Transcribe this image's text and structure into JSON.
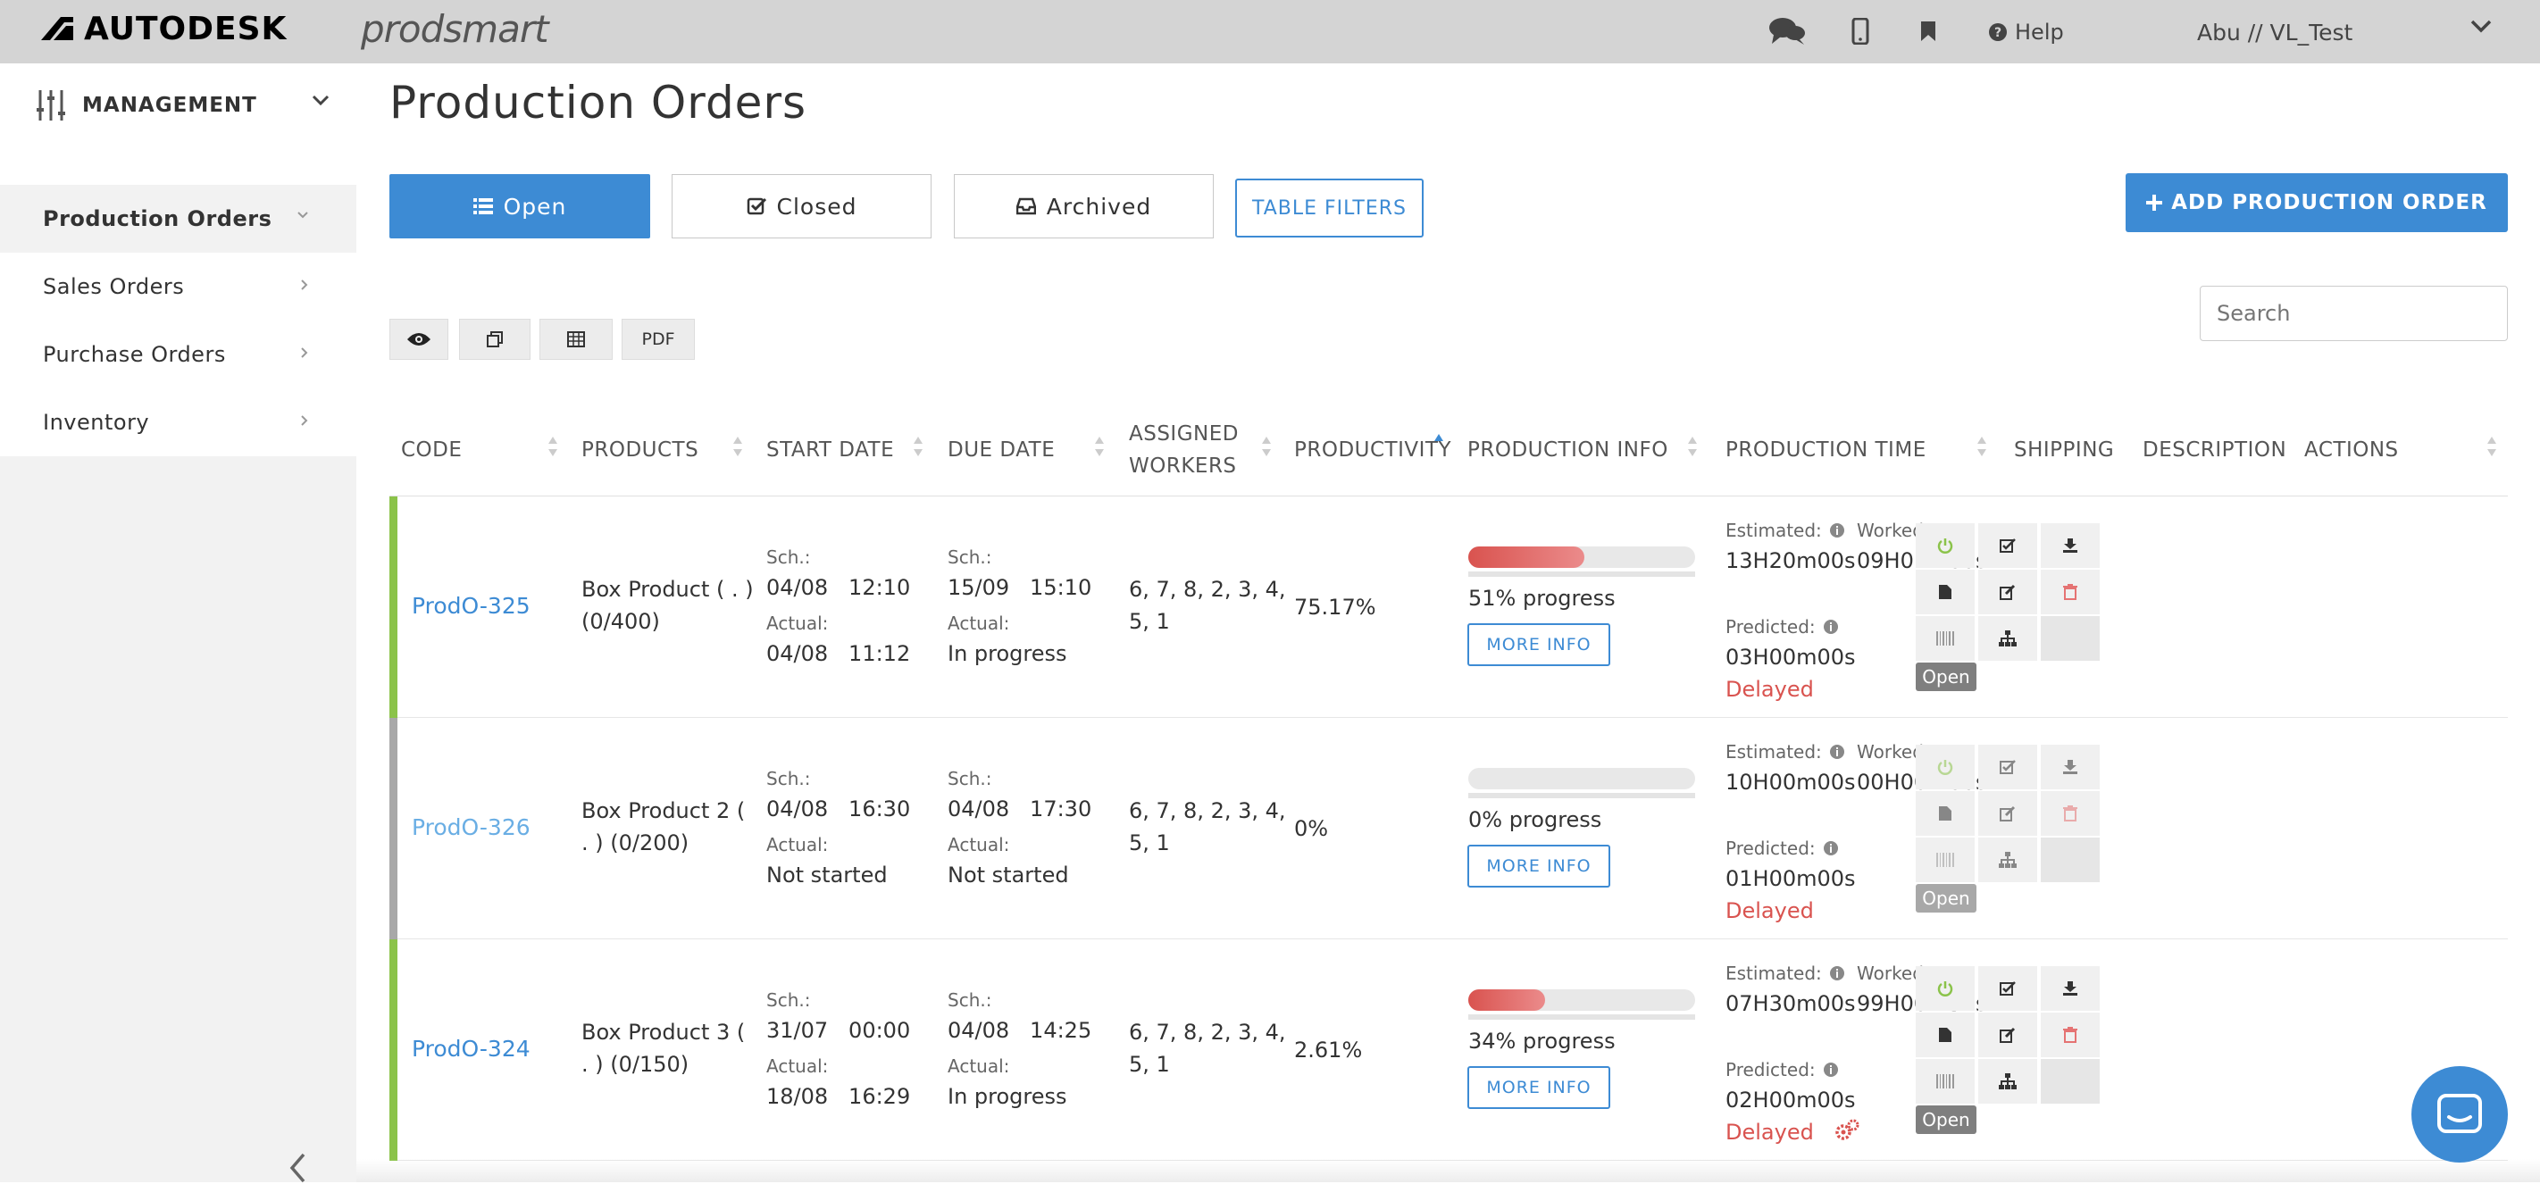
{
  "topbar": {
    "brand": "AUTODESK",
    "product": "prodsmart",
    "help_label": "Help",
    "user_label": "Abu // VL_Test"
  },
  "sidebar": {
    "section_label": "MANAGEMENT",
    "items": [
      {
        "label": "Production Orders",
        "active": true
      },
      {
        "label": "Sales Orders"
      },
      {
        "label": "Purchase Orders"
      },
      {
        "label": "Inventory"
      }
    ]
  },
  "page": {
    "title": "Production Orders",
    "tabs": {
      "open": "Open",
      "closed": "Closed",
      "archived": "Archived"
    },
    "table_filters": "TABLE FILTERS",
    "add_button": "ADD PRODUCTION ORDER",
    "search_placeholder": "Search",
    "pdf_label": "PDF"
  },
  "table": {
    "headers": {
      "code": "CODE",
      "products": "PRODUCTS",
      "start": "START DATE",
      "due": "DUE DATE",
      "workers_1": "ASSIGNED",
      "workers_2": "WORKERS",
      "productivity": "PRODUCTIVITY",
      "prod_info": "PRODUCTION INFO",
      "prod_time": "PRODUCTION TIME",
      "shipping": "SHIPPING",
      "description": "DESCRIPTION",
      "actions": "ACTIONS"
    },
    "labels": {
      "sch": "Sch.:",
      "actual": "Actual:",
      "estimated": "Estimated:",
      "worked": "Worked:",
      "predicted": "Predicted:",
      "more_info": "MORE INFO",
      "open_badge": "Open"
    },
    "rows": [
      {
        "code": "ProdO-325",
        "product_1": "Box Product ( . )",
        "product_2": "(0/400)",
        "start_sch": "04/08   12:10",
        "start_actual": "04/08   11:12",
        "due_sch": "15/09   15:10",
        "due_actual": "In progress",
        "workers_1": "6, 7, 8, 2, 3, 4,",
        "workers_2": "5, 1",
        "productivity": "75.17%",
        "progress": 0.51,
        "progress_text": "51% progress",
        "estimated": "13H20m00s",
        "worked": "09H01m00s",
        "predicted": "03H00m00s",
        "status": "Delayed"
      },
      {
        "code": "ProdO-326",
        "product_1": "Box Product 2 (",
        "product_2": ". ) (0/200)",
        "start_sch": "04/08   16:30",
        "start_actual": "Not started",
        "due_sch": "04/08   17:30",
        "due_actual": "Not started",
        "workers_1": "6, 7, 8, 2, 3, 4,",
        "workers_2": "5, 1",
        "productivity": "0%",
        "progress": 0,
        "progress_text": "0% progress",
        "estimated": "10H00m00s",
        "worked": "00H00m00s",
        "predicted": "01H00m00s",
        "status": "Delayed"
      },
      {
        "code": "ProdO-324",
        "product_1": "Box Product 3 (",
        "product_2": ". ) (0/150)",
        "start_sch": "31/07   00:00",
        "start_actual": "18/08   16:29",
        "due_sch": "04/08   14:25",
        "due_actual": "In progress",
        "workers_1": "6, 7, 8, 2, 3, 4,",
        "workers_2": "5, 1",
        "productivity": "2.61%",
        "progress": 0.34,
        "progress_text": "34% progress",
        "estimated": "07H30m00s",
        "worked": "99H00m54s",
        "predicted": "02H00m00s",
        "status": "Delayed"
      }
    ]
  },
  "colors": {
    "primary": "#3d8bd4",
    "green": "#8bc34a",
    "gray_bar": "#a8a8a8",
    "danger": "#d9534f"
  }
}
